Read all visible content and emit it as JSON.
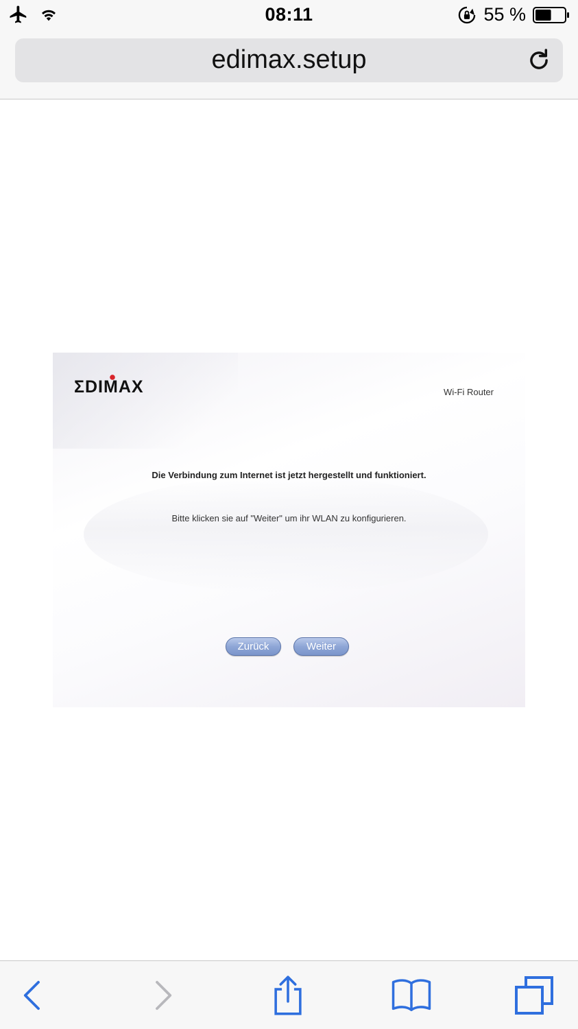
{
  "status_bar": {
    "time": "08:11",
    "battery_percent": "55 %",
    "battery_level": 0.55
  },
  "browser": {
    "address": "edimax.setup"
  },
  "page": {
    "logo_text": "EDIMAX",
    "product_label": "Wi-Fi Router",
    "message_main": "Die Verbindung zum Internet ist jetzt hergestellt und funktioniert.",
    "message_sub": "Bitte klicken sie auf \"Weiter\" um ihr WLAN zu konfigurieren.",
    "back_button": "Zurück",
    "next_button": "Weiter"
  },
  "toolbar": {
    "icons": [
      "back-icon",
      "forward-icon",
      "share-icon",
      "bookmarks-icon",
      "tabs-icon"
    ]
  },
  "colors": {
    "ios_blue": "#2f6fde",
    "ios_disabled": "#b8b8bc",
    "button_blue": "#8ea6d6",
    "logo_red": "#d8232a"
  }
}
